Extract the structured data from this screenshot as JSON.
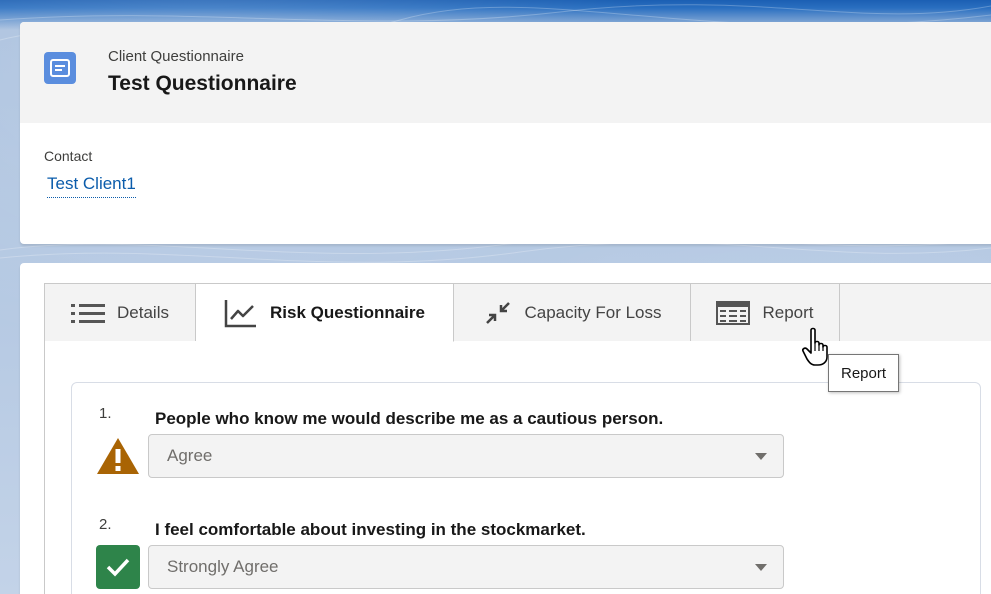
{
  "record": {
    "type_label": "Client Questionnaire",
    "name": "Test Questionnaire",
    "icon": "questionnaire-icon"
  },
  "fields": {
    "contact_label": "Contact",
    "contact_value": "Test Client1"
  },
  "tabs": [
    {
      "label": "Details",
      "icon": "list-icon",
      "active": false
    },
    {
      "label": "Risk Questionnaire",
      "icon": "line-chart-icon",
      "active": true
    },
    {
      "label": "Capacity For Loss",
      "icon": "contract-icon",
      "active": false
    },
    {
      "label": "Report",
      "icon": "table-icon",
      "active": false
    }
  ],
  "tooltip": "Report",
  "questions": [
    {
      "number": "1.",
      "text": "People who know me would describe me as a cautious person.",
      "answer": "Agree",
      "status_icon": "warning-icon"
    },
    {
      "number": "2.",
      "text": "I feel comfortable about investing in the stockmarket.",
      "answer": "Strongly Agree",
      "status_icon": "check-icon"
    }
  ],
  "colors": {
    "brand_blue": "#0b5cab",
    "icon_blue": "#5a8dde",
    "warning": "#a96404",
    "success": "#2e844a"
  }
}
